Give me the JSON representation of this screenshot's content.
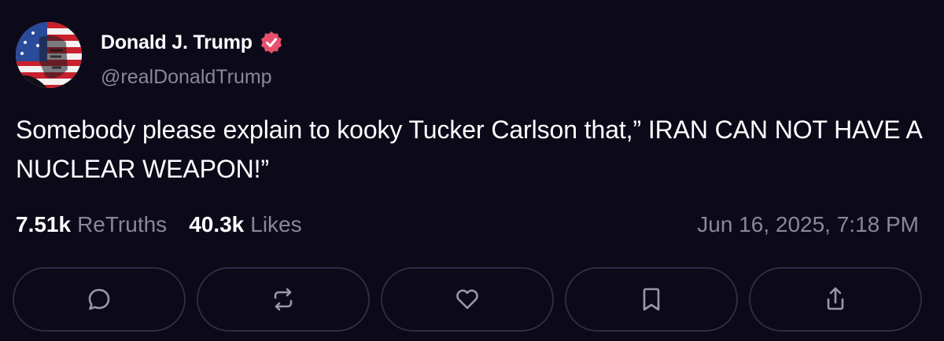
{
  "author": {
    "display_name": "Donald J. Trump",
    "handle": "@realDonaldTrump",
    "verified": true,
    "verified_color": "#e8506b"
  },
  "post": {
    "text": "Somebody please explain to kooky Tucker Carlson that,” IRAN CAN NOT HAVE A NUCLEAR WEAPON!”"
  },
  "stats": {
    "retruths_count": "7.51k",
    "retruths_label": "ReTruths",
    "likes_count": "40.3k",
    "likes_label": "Likes",
    "timestamp": "Jun 16, 2025, 7:18 PM"
  },
  "actions": [
    {
      "name": "reply",
      "icon": "comment-icon"
    },
    {
      "name": "retruth",
      "icon": "repost-icon"
    },
    {
      "name": "like",
      "icon": "heart-icon"
    },
    {
      "name": "bookmark",
      "icon": "bookmark-icon"
    },
    {
      "name": "share",
      "icon": "share-icon"
    }
  ],
  "colors": {
    "background": "#0c0919",
    "text_primary": "#ffffff",
    "text_secondary": "#8a879a",
    "button_border": "#2e2b44"
  }
}
